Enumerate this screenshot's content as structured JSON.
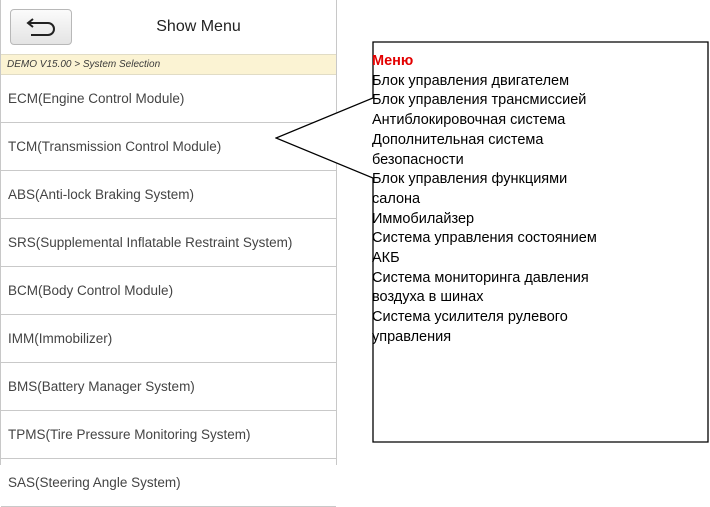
{
  "header": {
    "title": "Show Menu",
    "back_icon": "back-arrow-icon"
  },
  "breadcrumb": "DEMO V15.00 > System Selection",
  "menu_items": [
    "ECM(Engine Control Module)",
    "TCM(Transmission Control Module)",
    "ABS(Anti-lock Braking System)",
    "SRS(Supplemental Inflatable Restraint System)",
    "BCM(Body Control Module)",
    "IMM(Immobilizer)",
    "BMS(Battery Manager System)",
    "TPMS(Tire Pressure Monitoring System)",
    "SAS(Steering Angle System)"
  ],
  "callout": {
    "title": "Меню",
    "lines": [
      "Блок управления двигателем",
      "Блок управления трансмиссией",
      "Антиблокировочная система",
      "Дополнительная система",
      "безопасности",
      "Блок управления функциями",
      "салона",
      "Иммобилайзер",
      "Система управления состоянием",
      "АКБ",
      "Система мониторинга давления",
      "воздуха в шинах",
      "Система усилителя рулевого",
      "управления"
    ]
  },
  "colors": {
    "breadcrumb_bg": "#fbf3d3",
    "callout_title": "#e30000",
    "divider": "#c9c9c9"
  }
}
